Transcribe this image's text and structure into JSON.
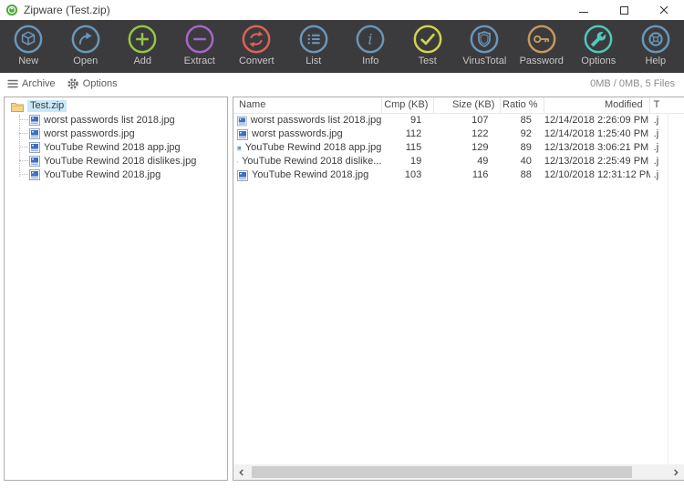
{
  "window": {
    "title": "Zipware (Test.zip)"
  },
  "toolbar": {
    "items": [
      {
        "label": "New",
        "icon": "cube-icon",
        "color": "#6a96b9"
      },
      {
        "label": "Open",
        "icon": "open-arrow-icon",
        "color": "#6a96b9"
      },
      {
        "label": "Add",
        "icon": "plus-icon",
        "color": "#93c845"
      },
      {
        "label": "Extract",
        "icon": "minus-icon",
        "color": "#a966c9"
      },
      {
        "label": "Convert",
        "icon": "convert-arrows-icon",
        "color": "#dd6358"
      },
      {
        "label": "List",
        "icon": "list-icon",
        "color": "#6a96b9"
      },
      {
        "label": "Info",
        "icon": "info-icon",
        "color": "#6a96b9"
      },
      {
        "label": "Test",
        "icon": "check-icon",
        "color": "#d2d44e"
      },
      {
        "label": "VirusTotal",
        "icon": "shield-icon",
        "color": "#6a96b9"
      },
      {
        "label": "Password",
        "icon": "key-icon",
        "color": "#c4995f"
      },
      {
        "label": "Options",
        "icon": "wrench-icon",
        "color": "#4fc9bd"
      },
      {
        "label": "Help",
        "icon": "lifering-icon",
        "color": "#6a96b9"
      }
    ]
  },
  "menubar": {
    "archive": "Archive",
    "options": "Options",
    "status": "0MB / 0MB, 5 Files"
  },
  "tree": {
    "root": "Test.zip",
    "items": [
      "worst passwords list 2018.jpg",
      "worst passwords.jpg",
      "YouTube Rewind 2018 app.jpg",
      "YouTube Rewind 2018 dislikes.jpg",
      "YouTube Rewind 2018.jpg"
    ]
  },
  "table": {
    "columns": [
      "Name",
      "Cmp (KB)",
      "Size (KB)",
      "Ratio %",
      "Modified",
      "T"
    ],
    "rows": [
      {
        "name": "worst passwords list 2018.jpg",
        "cmp": "91",
        "size": "107",
        "ratio": "85",
        "modified": "12/14/2018 2:26:09 PM",
        "type": ".j"
      },
      {
        "name": "worst passwords.jpg",
        "cmp": "112",
        "size": "122",
        "ratio": "92",
        "modified": "12/14/2018 1:25:40 PM",
        "type": ".j"
      },
      {
        "name": "YouTube Rewind 2018 app.jpg",
        "cmp": "115",
        "size": "129",
        "ratio": "89",
        "modified": "12/13/2018 3:06:21 PM",
        "type": ".j"
      },
      {
        "name": "YouTube Rewind 2018 dislike...",
        "cmp": "19",
        "size": "49",
        "ratio": "40",
        "modified": "12/13/2018 2:25:49 PM",
        "type": ".j"
      },
      {
        "name": "YouTube Rewind 2018.jpg",
        "cmp": "103",
        "size": "116",
        "ratio": "88",
        "modified": "12/10/2018 12:31:12 PM",
        "type": ".j"
      }
    ]
  },
  "colors": {
    "toolbar_bg": "#3b3b3d",
    "selection": "#c9e7f9",
    "logo_green": "#53a93f"
  }
}
